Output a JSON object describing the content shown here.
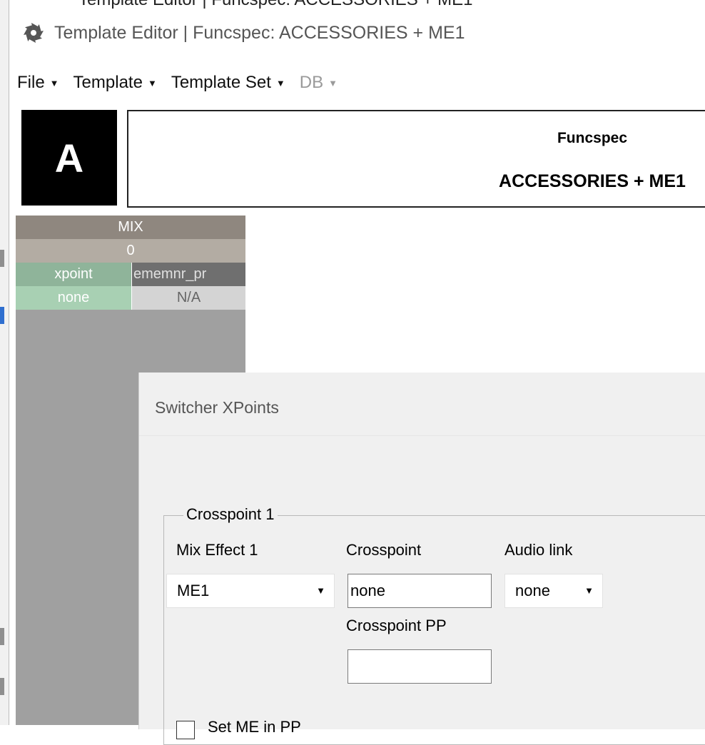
{
  "window": {
    "title": "Template Editor | Funcspec: ACCESSORIES + ME1",
    "clipped_heading": "Template Editor | Funcspec: ACCESSORIES + ME1"
  },
  "menu": [
    {
      "label": "File",
      "enabled": true
    },
    {
      "label": "Template",
      "enabled": true
    },
    {
      "label": "Template Set",
      "enabled": true
    },
    {
      "label": "DB",
      "enabled": false
    }
  ],
  "header": {
    "mode_letter": "A",
    "line1": "Funcspec",
    "line2": "ACCESSORIES + ME1"
  },
  "grid": {
    "title": "MIX",
    "index": "0",
    "type_label": "xpoint",
    "name_label": "ememnr_pr",
    "type_value": "none",
    "name_value": "N/A"
  },
  "dialog": {
    "title": "Switcher XPoints",
    "group_title": "Crosspoint 1",
    "me_label": "Mix Effect 1",
    "me_value": "ME1",
    "crosspoint_label": "Crosspoint",
    "crosspoint_value": "none",
    "audio_label": "Audio link",
    "audio_value": "none",
    "crosspoint_pp_label": "Crosspoint PP",
    "crosspoint_pp_value": "",
    "set_me_label": "Set ME in PP",
    "set_me_checked": false
  },
  "colors": {
    "mix_header": "#8f877f",
    "index_row": "#b3aca3",
    "xpoint_green": "#8fb49a",
    "none_green": "#a8d0b3",
    "name_gray": "#6f6f6f"
  },
  "icons": {
    "app_logo": "pinwheel-logo-icon",
    "menu_caret": "caret-down-icon"
  }
}
